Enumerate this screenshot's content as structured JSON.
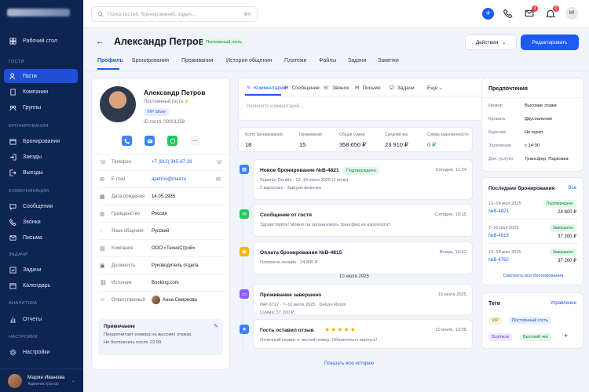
{
  "sidebar": {
    "items": {
      "desktop": "Рабочий стол",
      "guests": "Гости",
      "companies": "Компании",
      "groups": "Группы",
      "bookings": "Бронирования",
      "checkins": "Заезды",
      "checkouts": "Выезды",
      "messages": "Сообщения",
      "calls": "Звонки",
      "letters": "Письма",
      "tasks": "Задачи",
      "calendar": "Календарь",
      "reports": "Отчеты",
      "settings": "Настройки"
    },
    "sections": {
      "guests": "ГОСТИ",
      "bookings": "БРОНИРОВАНИЯ",
      "comms": "КОММУНИКАЦИИ",
      "tasks": "ЗАДАЧИ",
      "analytics": "АНАЛИТИКА",
      "settings": "НАСТРОЙКИ"
    },
    "user": {
      "name": "Мария Иванова",
      "role": "Администратор"
    }
  },
  "topbar": {
    "search_placeholder": "Поиск гостей, бронирований, задач...",
    "shortcut": "⌘K",
    "mail_badge": "3",
    "bell_badge": "2",
    "avatar": "MI"
  },
  "header": {
    "title": "Александр Петров",
    "status": "Постоянный гость",
    "actions": "Действия",
    "edit": "Редактировать"
  },
  "tabs": [
    "Профиль",
    "Бронирования",
    "Проживания",
    "История общения",
    "Платежи",
    "Файлы",
    "Задачи",
    "Заметки"
  ],
  "profile": {
    "name": "Александр Петров",
    "subtitle": "Постоянный гость",
    "vip": "VIP Silver",
    "id": "ID гостя: 00001258",
    "fields": [
      {
        "k": "Телефон",
        "v": "+7 (912) 345-67-39"
      },
      {
        "k": "E-mail",
        "v": "apetrov@mail.ru"
      },
      {
        "k": "Дата рождения",
        "v": "14.05.1985"
      },
      {
        "k": "Гражданство",
        "v": "Россия"
      },
      {
        "k": "Язык общения",
        "v": "Русский"
      },
      {
        "k": "Компания",
        "v": "ООО «ТехноСтрой»"
      },
      {
        "k": "Должность",
        "v": "Руководитель отдела"
      },
      {
        "k": "Источник",
        "v": "Booking.com"
      },
      {
        "k": "Ответственный",
        "v": "Анна Смирнова"
      }
    ],
    "note": {
      "title": "Примечание",
      "text1": "Предпочитает номера на высоких этажах.",
      "text2": "Не беспокоить после 22:00."
    }
  },
  "composer": {
    "tabs": [
      "Комментарий",
      "Сообщение",
      "Звонок",
      "Письмо",
      "Задачи"
    ],
    "more": "Еще",
    "placeholder": "Напишите комментарий..."
  },
  "stats": [
    {
      "k": "Всего бронирований",
      "v": "18"
    },
    {
      "k": "Проживаний",
      "v": "15"
    },
    {
      "k": "Общая сумма",
      "v": "358 650 ₽"
    },
    {
      "k": "Средний чек",
      "v": "23 910 ₽"
    },
    {
      "k": "Сумма задолженности",
      "v": "0 ₽"
    }
  ],
  "timeline": {
    "items": [
      {
        "title": "Новое бронирование №B-4821",
        "badge": "Подтверждено",
        "time": "Сегодня, 11:24",
        "l1": "Superior Double · 12–14 июля 2025 (2 ночи)",
        "l2": "2 взрослых · Завтрак включен"
      },
      {
        "title": "Сообщение от гостя",
        "time": "Сегодня, 10:15",
        "l1": "Здравствуйте! Можно ли организовать трансфер из аэропорта?"
      },
      {
        "title": "Оплата бронирования №B-4815",
        "time": "Вчера, 16:42",
        "l1": "Оплачено онлайн · 24 800 ₽"
      },
      {
        "title": "Проживание завершено",
        "time": "10 июля 2025",
        "l1": "№P-3712 · 7–10 июля 2025 · Deluxe Room",
        "l2": "Сумма: 37 200 ₽"
      },
      {
        "title": "Гость оставил отзыв",
        "stars": "★★★★★",
        "time": "10 июля, 12:05",
        "l1": "Отличный сервис и чистый номер. Обязательно вернусь!"
      }
    ],
    "divider": "10 июля 2025",
    "more": "Показать всю историю"
  },
  "prefs": {
    "title": "Предпочтения",
    "rows": [
      {
        "k": "Номер",
        "v": "Высокие этажи"
      },
      {
        "k": "Кровать",
        "v": "Двуспальная"
      },
      {
        "k": "Курение",
        "v": "Не курит"
      },
      {
        "k": "Заселение",
        "v": "с 14:00"
      },
      {
        "k": "Доп. услуги",
        "v": "Трансфер, Парковка"
      }
    ]
  },
  "recent": {
    "title": "Последние бронирования",
    "all": "Все",
    "rows": [
      {
        "date": "12–14 июл 2025",
        "id": "№B-4821",
        "status": "Подтверждено",
        "sum": "24 800 ₽"
      },
      {
        "date": "7–10 июл 2025",
        "id": "№B-4815",
        "status": "Завершено",
        "sum": "37 200 ₽"
      },
      {
        "date": "15–18 июн 2025",
        "id": "№B-4762",
        "status": "Завершено",
        "sum": "37 200 ₽"
      }
    ],
    "view_all": "Смотреть все бронирования"
  },
  "tags": {
    "title": "Теги",
    "manage": "Управление",
    "items": [
      "VIP",
      "Постоянный гость",
      "Business",
      "Высокий чек"
    ]
  }
}
